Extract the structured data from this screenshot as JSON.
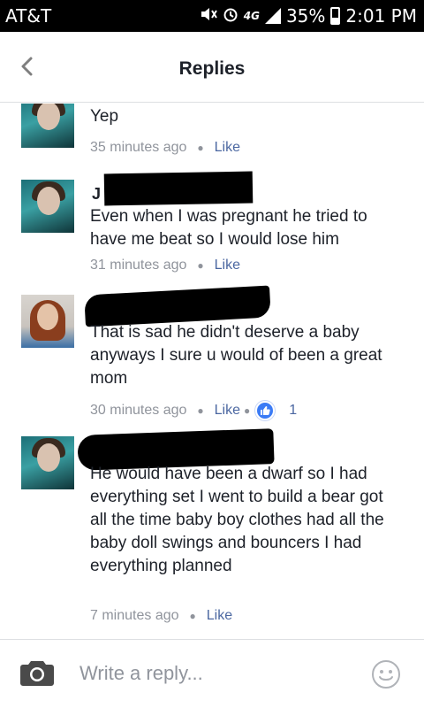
{
  "status_bar": {
    "carrier": "AT&T",
    "network": "4G",
    "battery": "35%",
    "time": "2:01 PM"
  },
  "header": {
    "title": "Replies"
  },
  "replies": [
    {
      "text": "Yep",
      "time": "35 minutes ago",
      "like_label": "Like"
    },
    {
      "name_partial": "J",
      "text": "Even when I was pregnant he tried to have me beat so I would lose him",
      "time": "31 minutes ago",
      "like_label": "Like"
    },
    {
      "text": "That is sad he didn't deserve a baby anyways I sure u would of been a great mom",
      "time": "30 minutes ago",
      "like_label": "Like",
      "reaction_count": "1"
    },
    {
      "text": "He would have been a dwarf so I had everything set I went to build a bear got all the time baby boy clothes had all the baby doll swings and bouncers I had everything planned",
      "time": "7 minutes ago",
      "like_label": "Like"
    }
  ],
  "composer": {
    "placeholder": "Write a reply..."
  },
  "colors": {
    "link": "#4b67a1",
    "meta": "#90949c",
    "reaction": "#3b7bf5"
  }
}
